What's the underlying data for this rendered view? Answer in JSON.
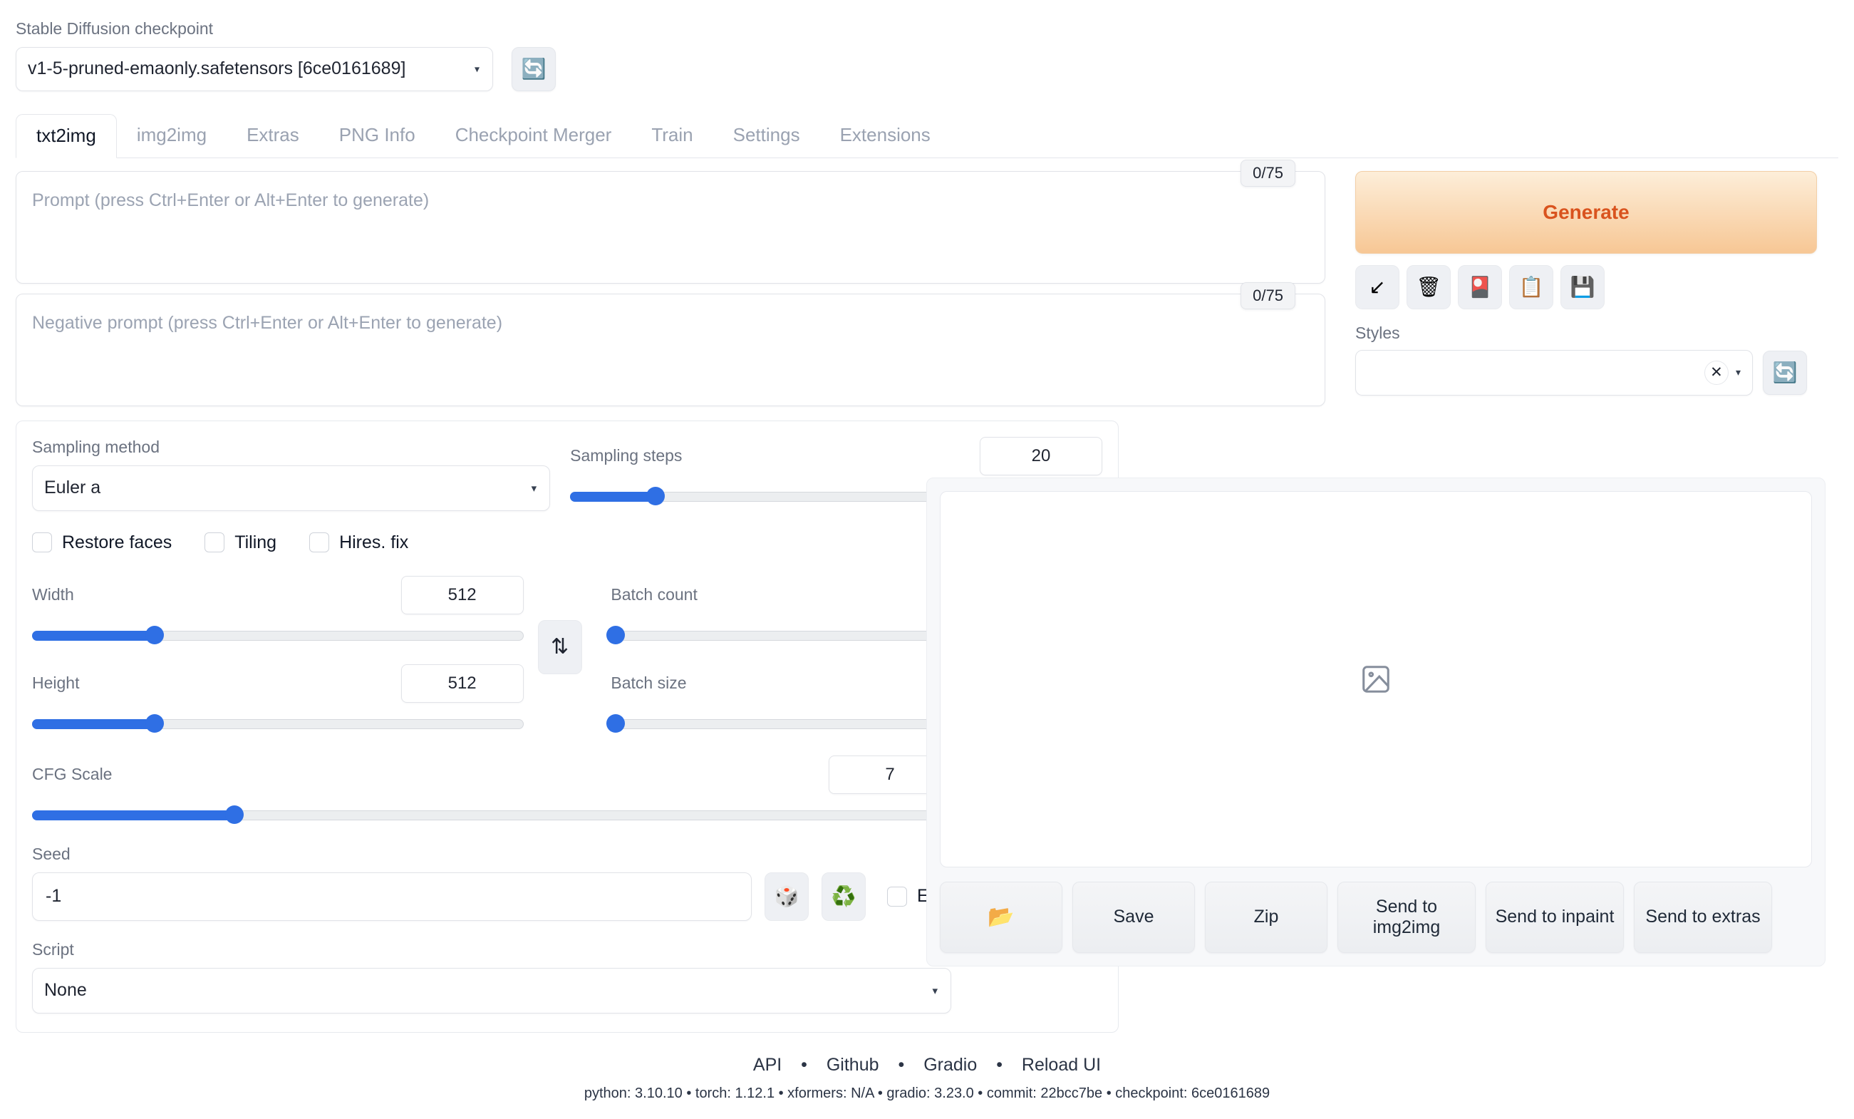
{
  "checkpoint": {
    "label": "Stable Diffusion checkpoint",
    "value": "v1-5-pruned-emaonly.safetensors [6ce0161689]",
    "refresh_icon": "🔄"
  },
  "tabs": [
    {
      "label": "txt2img",
      "active": true
    },
    {
      "label": "img2img",
      "active": false
    },
    {
      "label": "Extras",
      "active": false
    },
    {
      "label": "PNG Info",
      "active": false
    },
    {
      "label": "Checkpoint Merger",
      "active": false
    },
    {
      "label": "Train",
      "active": false
    },
    {
      "label": "Settings",
      "active": false
    },
    {
      "label": "Extensions",
      "active": false
    }
  ],
  "prompt": {
    "placeholder": "Prompt (press Ctrl+Enter or Alt+Enter to generate)",
    "counter": "0/75",
    "value": ""
  },
  "negative_prompt": {
    "placeholder": "Negative prompt (press Ctrl+Enter or Alt+Enter to generate)",
    "counter": "0/75",
    "value": ""
  },
  "generate": {
    "label": "Generate",
    "color": "#d9531e"
  },
  "tools": [
    {
      "name": "arrow-down-left-icon",
      "glyph": "↙"
    },
    {
      "name": "wastebasket-icon",
      "glyph": "🗑"
    },
    {
      "name": "playing-card-icon",
      "glyph": "🎴"
    },
    {
      "name": "clipboard-icon",
      "glyph": "📋"
    },
    {
      "name": "floppy-disk-icon",
      "glyph": "💾"
    }
  ],
  "styles": {
    "label": "Styles",
    "value": "",
    "clear_glyph": "✕",
    "refresh_icon": "🔄"
  },
  "sampling": {
    "method_label": "Sampling method",
    "method_value": "Euler a",
    "steps_label": "Sampling steps",
    "steps_value": "20",
    "steps_percent": 16
  },
  "checkboxes": [
    {
      "label": "Restore faces",
      "checked": false
    },
    {
      "label": "Tiling",
      "checked": false
    },
    {
      "label": "Hires. fix",
      "checked": false
    }
  ],
  "dimensions": {
    "width_label": "Width",
    "width_value": "512",
    "width_percent": 25,
    "height_label": "Height",
    "height_value": "512",
    "height_percent": 25,
    "swap_glyph": "⇅",
    "cfg_label": "CFG Scale",
    "cfg_value": "7",
    "cfg_percent": 22
  },
  "batch": {
    "count_label": "Batch count",
    "count_value": "1",
    "count_percent": 1,
    "size_label": "Batch size",
    "size_value": "1",
    "size_percent": 1
  },
  "seed": {
    "label": "Seed",
    "value": "-1",
    "dice_icon": "🎲",
    "recycle_icon": "♻️",
    "extra_label": "Extra",
    "extra_checked": false
  },
  "script": {
    "label": "Script",
    "value": "None"
  },
  "output": {
    "placeholder_icon": "image-placeholder-icon",
    "buttons": [
      {
        "name": "open-folder-button",
        "label": "📂"
      },
      {
        "name": "save-button",
        "label": "Save"
      },
      {
        "name": "zip-button",
        "label": "Zip"
      },
      {
        "name": "send-to-img2img-button",
        "label": "Send to img2img"
      },
      {
        "name": "send-to-inpaint-button",
        "label": "Send to inpaint"
      },
      {
        "name": "send-to-extras-button",
        "label": "Send to extras"
      }
    ]
  },
  "footer": {
    "links": [
      "API",
      "Github",
      "Gradio",
      "Reload UI"
    ],
    "separator": "•",
    "versions": "python: 3.10.10  •  torch: 1.12.1  •  xformers: N/A  •  gradio: 3.23.0  •  commit: 22bcc7be  •  checkpoint: 6ce0161689"
  }
}
